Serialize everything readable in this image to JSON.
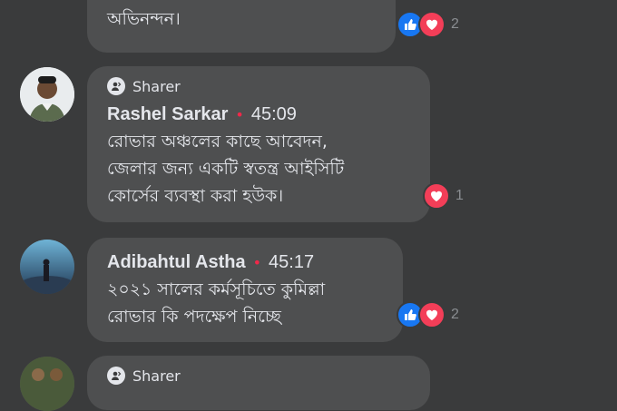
{
  "comments": [
    {
      "text": "স্যার এর জন্য শুভেচ্ছা ও\nঅভিনন্দন।",
      "reaction_count": "2",
      "reactions": [
        "like-icon",
        "love-icon"
      ]
    },
    {
      "badge_label": "Sharer",
      "author": "Rashel Sarkar",
      "time": "45:09",
      "text": "রোভার অঞ্চলের কাছে আবেদন,\nজেলার জন্য একটি স্বতন্ত্র আইসিটি\nকোর্সের ব্যবস্থা করা হউক।",
      "reaction_count": "1",
      "reactions": [
        "love-icon"
      ]
    },
    {
      "author": "Adibahtul Astha",
      "time": "45:17",
      "text": "২০২১ সালের কর্মসূচিতে কুমিল্লা\nরোভার কি পদক্ষেপ নিচ্ছে",
      "reaction_count": "2",
      "reactions": [
        "like-icon",
        "love-icon"
      ]
    },
    {
      "badge_label": "Sharer"
    }
  ],
  "colors": {
    "background": "#3a3b3c",
    "bubble": "#4e4f50",
    "like": "#1877f2",
    "love": "#f33e58",
    "time_dot": "#f02849"
  }
}
